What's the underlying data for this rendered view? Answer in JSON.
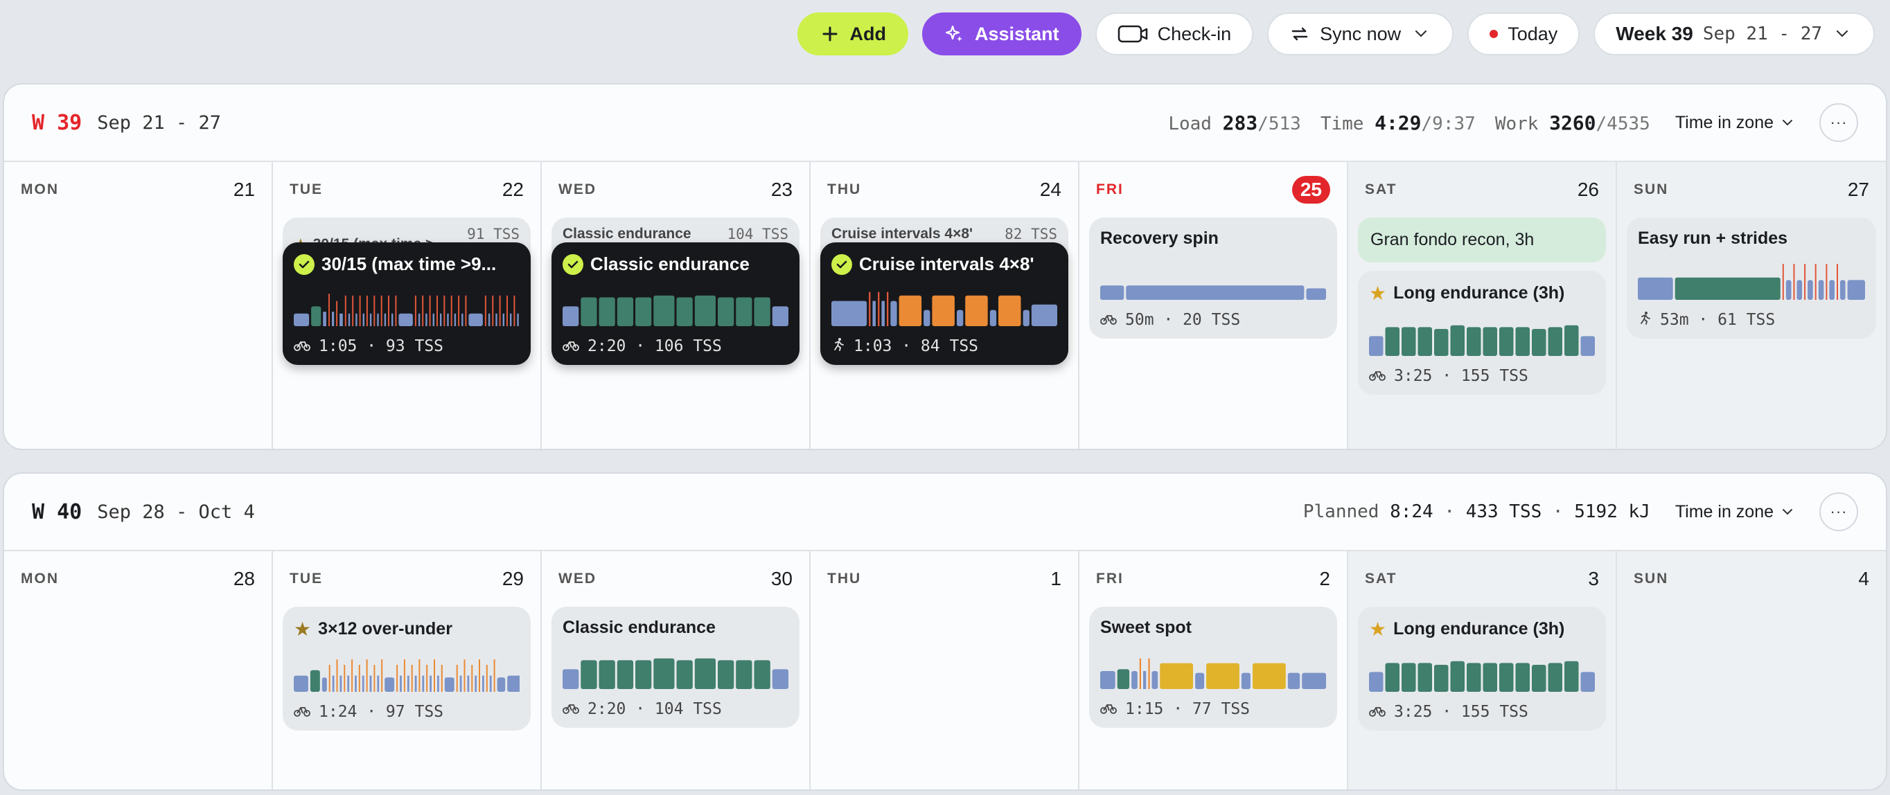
{
  "toolbar": {
    "add": "Add",
    "assistant": "Assistant",
    "checkin": "Check-in",
    "sync": "Sync now",
    "today": "Today",
    "week_label": "Week 39",
    "week_range": "Sep 21 - 27"
  },
  "weeks": [
    {
      "num": "W 39",
      "range": "Sep 21 - 27",
      "stats": {
        "load_label": "Load",
        "load": "283",
        "load_max": "/513",
        "time_label": "Time",
        "time": "4:29",
        "time_max": "/9:37",
        "work_label": "Work",
        "work": "3260",
        "work_max": "/4535"
      },
      "tiz": "Time in zone",
      "days": [
        {
          "dow": "MON",
          "num": "21"
        },
        {
          "dow": "TUE",
          "num": "22",
          "stack": {
            "title": "30/15 (max time >...",
            "tss": "91 TSS"
          },
          "card": {
            "title": "30/15 (max time >9...",
            "meta": "1:05 · 93 TSS"
          }
        },
        {
          "dow": "WED",
          "num": "23",
          "stack": {
            "title": "Classic endurance",
            "tss": "104 TSS"
          },
          "card": {
            "title": "Classic endurance",
            "meta": "2:20 · 106 TSS"
          }
        },
        {
          "dow": "THU",
          "num": "24",
          "stack": {
            "title": "Cruise intervals 4×8'",
            "tss": "82 TSS"
          },
          "card": {
            "title": "Cruise intervals 4×8'",
            "meta": "1:03 · 84 TSS"
          }
        },
        {
          "dow": "FRI",
          "num": "25",
          "card": {
            "title": "Recovery spin",
            "meta": "50m · 20 TSS"
          }
        },
        {
          "dow": "SAT",
          "num": "26",
          "note": "Gran fondo recon, 3h",
          "card": {
            "title": "Long endurance (3h)",
            "meta": "3:25 · 155 TSS"
          }
        },
        {
          "dow": "SUN",
          "num": "27",
          "card": {
            "title": "Easy run + strides",
            "meta": "53m · 61 TSS"
          }
        }
      ]
    },
    {
      "num": "W 40",
      "range": "Sep 28 - Oct 4",
      "stats": {
        "planned_label": "Planned",
        "planned_time": "8:24",
        "planned_tss": "433 TSS",
        "planned_kj": "5192 kJ"
      },
      "tiz": "Time in zone",
      "days": [
        {
          "dow": "MON",
          "num": "28"
        },
        {
          "dow": "TUE",
          "num": "29",
          "card": {
            "title": "3×12 over-under",
            "meta": "1:24 · 97 TSS"
          }
        },
        {
          "dow": "WED",
          "num": "30",
          "card": {
            "title": "Classic endurance",
            "meta": "2:20 · 104 TSS"
          }
        },
        {
          "dow": "THU",
          "num": "1"
        },
        {
          "dow": "FRI",
          "num": "2",
          "card": {
            "title": "Sweet spot",
            "meta": "1:15 · 77 TSS"
          }
        },
        {
          "dow": "SAT",
          "num": "3",
          "card": {
            "title": "Long endurance (3h)",
            "meta": "3:25 · 155 TSS"
          }
        },
        {
          "dow": "SUN",
          "num": "4"
        }
      ]
    }
  ],
  "colors": {
    "z1": "#7b93c7",
    "z2": "#3f7f6b",
    "z3": "#e0b32b",
    "z4": "#ea8a34",
    "z5": "#e0573a",
    "accent_add": "#cdf04a",
    "accent_assistant": "#8a4de8",
    "today": "#e3262b"
  }
}
